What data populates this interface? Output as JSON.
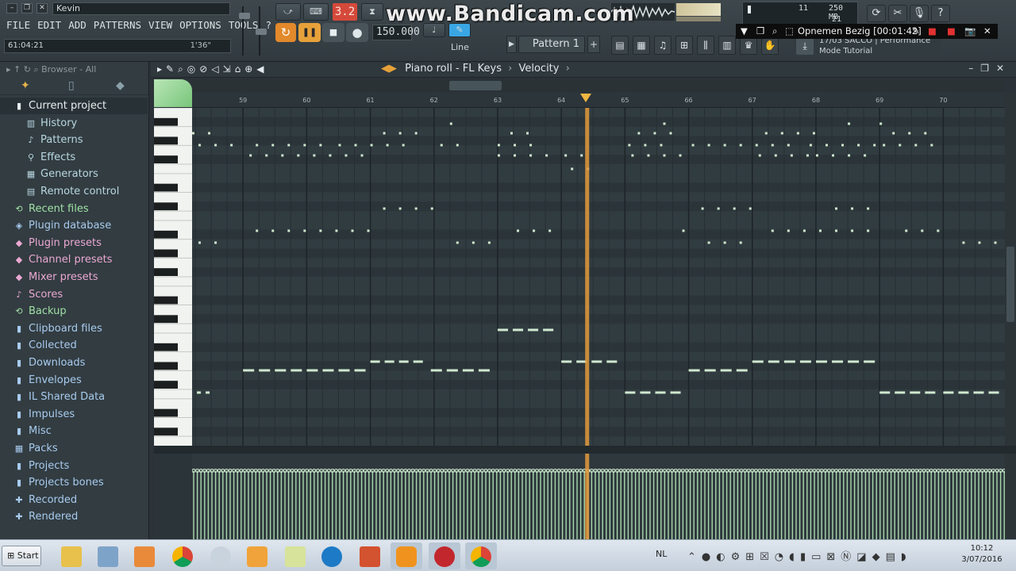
{
  "topbar": {
    "title_text": "Kevin",
    "menu": [
      "FILE",
      "EDIT",
      "ADD",
      "PATTERNS",
      "VIEW",
      "OPTIONS",
      "TOOLS",
      "?"
    ],
    "time_left": "61:04:21",
    "time_right": "1'36\"",
    "snap_value": "3.2",
    "tempo": "150.000",
    "line_mode": "Line",
    "pattern_name": "Pattern 1",
    "pattern_add": "+",
    "cpu_line1": "11",
    "mem_line": "250 MB",
    "poly_line": "21",
    "hint_title": "SACCO | Performance",
    "hint_sub": "Mode Tutorial",
    "hint_prefix": "17/03"
  },
  "watermark": "www.Bandicam.com",
  "recording": {
    "label": "Opnemen Bezig [00:01:42]"
  },
  "browser": {
    "header": "Browser - All",
    "items": [
      {
        "label": "Current project",
        "icon": "folder-icon",
        "color": "#e9eef0",
        "indent": 0
      },
      {
        "label": "History",
        "icon": "history-icon",
        "color": "#b8d7e0",
        "indent": 1
      },
      {
        "label": "Patterns",
        "icon": "note-icon",
        "color": "#b8d7e0",
        "indent": 1
      },
      {
        "label": "Effects",
        "icon": "plug-icon",
        "color": "#b8d7e0",
        "indent": 1
      },
      {
        "label": "Generators",
        "icon": "generator-icon",
        "color": "#b8d7e0",
        "indent": 1
      },
      {
        "label": "Remote control",
        "icon": "remote-icon",
        "color": "#b8d7e0",
        "indent": 1
      },
      {
        "label": "Recent files",
        "icon": "recent-icon",
        "color": "#9fe0a4",
        "indent": 0
      },
      {
        "label": "Plugin database",
        "icon": "plugin-icon",
        "color": "#a8cbee",
        "indent": 0
      },
      {
        "label": "Plugin presets",
        "icon": "preset-icon",
        "color": "#eba8d2",
        "indent": 0
      },
      {
        "label": "Channel presets",
        "icon": "preset-icon",
        "color": "#eba8d2",
        "indent": 0
      },
      {
        "label": "Mixer presets",
        "icon": "preset-icon",
        "color": "#eba8d2",
        "indent": 0
      },
      {
        "label": "Scores",
        "icon": "note-icon",
        "color": "#eba8d2",
        "indent": 0
      },
      {
        "label": "Backup",
        "icon": "backup-icon",
        "color": "#9fe0a4",
        "indent": 0
      },
      {
        "label": "Clipboard files",
        "icon": "folder-icon",
        "color": "#a8cbee",
        "indent": 0
      },
      {
        "label": "Collected",
        "icon": "folder-icon",
        "color": "#a8cbee",
        "indent": 0
      },
      {
        "label": "Downloads",
        "icon": "folder-icon",
        "color": "#a8cbee",
        "indent": 0
      },
      {
        "label": "Envelopes",
        "icon": "folder-icon",
        "color": "#a8cbee",
        "indent": 0
      },
      {
        "label": "IL Shared Data",
        "icon": "folder-icon",
        "color": "#a8cbee",
        "indent": 0
      },
      {
        "label": "Impulses",
        "icon": "folder-icon",
        "color": "#a8cbee",
        "indent": 0
      },
      {
        "label": "Misc",
        "icon": "folder-icon",
        "color": "#a8cbee",
        "indent": 0
      },
      {
        "label": "Packs",
        "icon": "pack-icon",
        "color": "#a8cbee",
        "indent": 0
      },
      {
        "label": "Projects",
        "icon": "folder-icon",
        "color": "#a8cbee",
        "indent": 0
      },
      {
        "label": "Projects bones",
        "icon": "folder-icon",
        "color": "#a8cbee",
        "indent": 0
      },
      {
        "label": "Recorded",
        "icon": "recorded-icon",
        "color": "#a8cbee",
        "indent": 0
      },
      {
        "label": "Rendered",
        "icon": "rendered-icon",
        "color": "#a8cbee",
        "indent": 0
      }
    ]
  },
  "piano_roll": {
    "title": "Piano roll - FL Keys",
    "target": "Velocity",
    "bars": [
      59,
      60,
      61,
      62,
      63,
      64,
      65,
      66,
      67,
      68,
      69,
      70
    ],
    "playhead_bar": 64.4,
    "notes": [
      {
        "row": 22,
        "start": 58.0,
        "end": 58.55,
        "n": 4
      },
      {
        "row": 22,
        "start": 59.0,
        "end": 61.0,
        "n": 8
      },
      {
        "row": 22,
        "start": 61.0,
        "end": 61.9,
        "n": 4
      },
      {
        "row": 22,
        "start": 61.95,
        "end": 62.95,
        "n": 4
      },
      {
        "row": 22,
        "start": 63.0,
        "end": 63.95,
        "n": 4
      },
      {
        "row": 22,
        "start": 64.0,
        "end": 64.95,
        "n": 4
      },
      {
        "row": 22,
        "start": 65.0,
        "end": 65.95,
        "n": 4
      },
      {
        "row": 22,
        "start": 66.0,
        "end": 67.0,
        "n": 4
      },
      {
        "row": 22,
        "start": 67.0,
        "end": 69.0,
        "n": 8
      },
      {
        "row": 22,
        "start": 69.0,
        "end": 69.95,
        "n": 4
      },
      {
        "row": 22,
        "start": 70.0,
        "end": 70.95,
        "n": 4
      }
    ],
    "velocity_level": 0.82
  },
  "taskbar": {
    "start_label": "Start",
    "lang": "NL",
    "time": "10:12",
    "date": "3/07/2016"
  }
}
